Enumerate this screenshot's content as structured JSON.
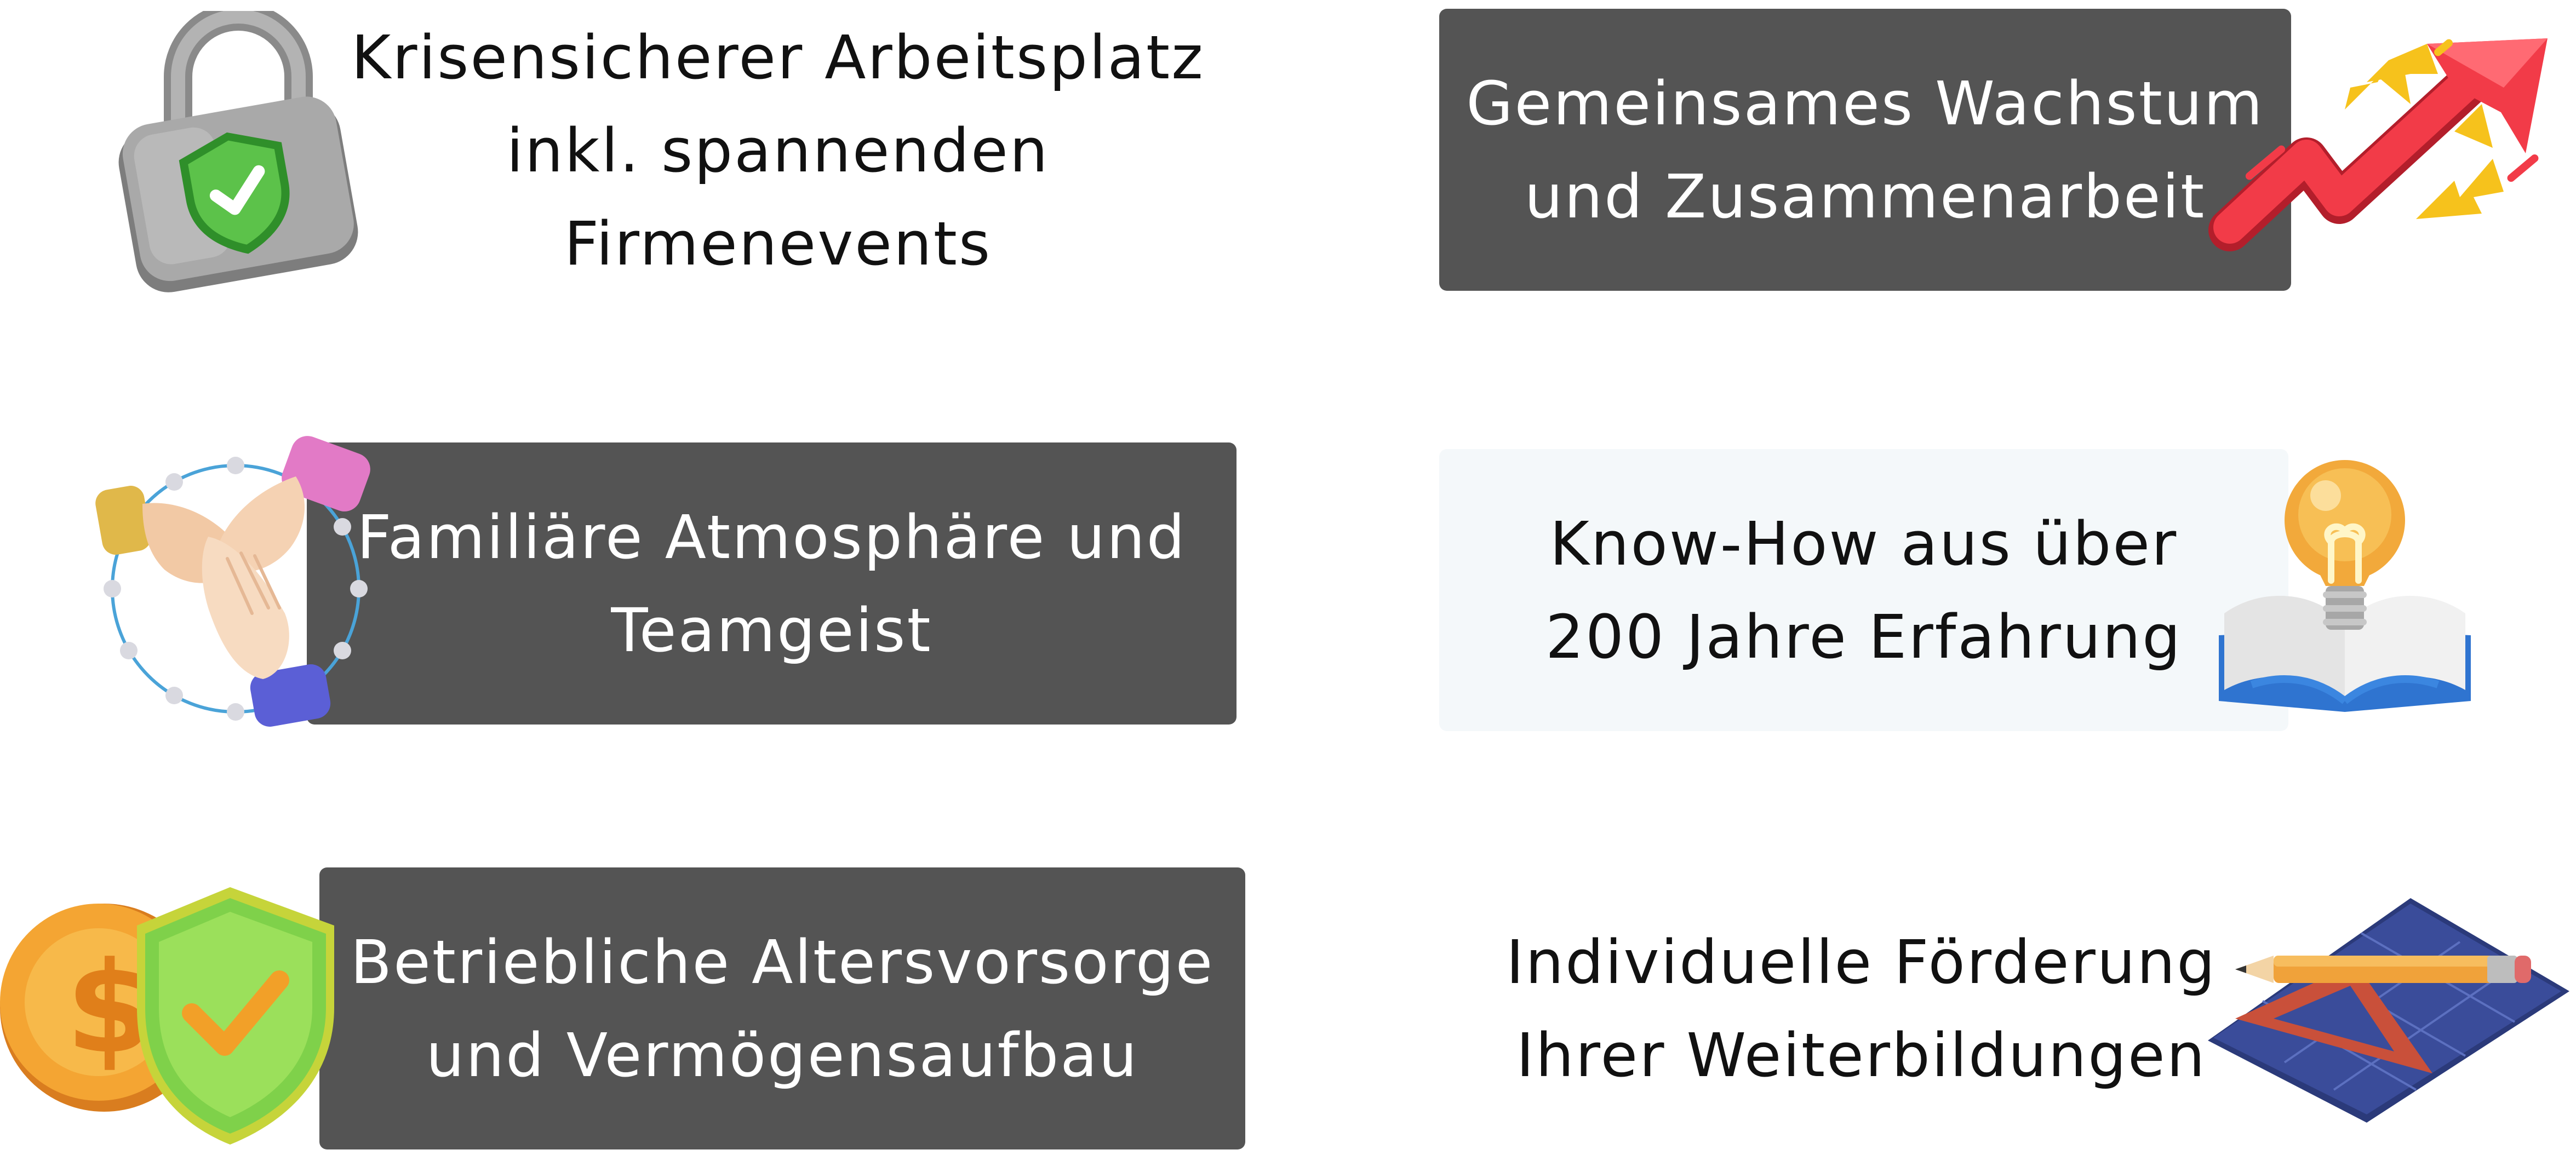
{
  "benefits": [
    {
      "lines": [
        "Krisensicherer Arbeitsplatz",
        "inkl. spannenden",
        "Firmenevents"
      ],
      "style": "plain",
      "icon": "padlock-shield-check-icon"
    },
    {
      "lines": [
        "Gemeinsames Wachstum",
        "und Zusammenarbeit"
      ],
      "style": "dark",
      "icon": "growth-arrows-icon"
    },
    {
      "lines": [
        "Familiäre Atmosphäre und",
        "Teamgeist"
      ],
      "style": "dark",
      "icon": "team-hands-icon"
    },
    {
      "lines": [
        "Know-How aus über",
        "200 Jahre Erfahrung"
      ],
      "style": "light",
      "icon": "lightbulb-book-icon"
    },
    {
      "lines": [
        "Betriebliche Altersvorsorge",
        "und Vermögensaufbau"
      ],
      "style": "dark",
      "icon": "coin-shield-icon"
    },
    {
      "lines": [
        "Individuelle Förderung",
        "Ihrer Weiterbildungen"
      ],
      "style": "plain",
      "icon": "pencil-blueprint-icon"
    }
  ],
  "colors": {
    "tile_dark": "#545454",
    "tile_light": "#f4f8fa",
    "text_dark": "#111111",
    "text_light": "#ffffff",
    "accent_red": "#f23b48",
    "accent_yellow": "#f6c21c",
    "accent_green": "#4cbc3c",
    "accent_blue": "#3b86e0"
  }
}
